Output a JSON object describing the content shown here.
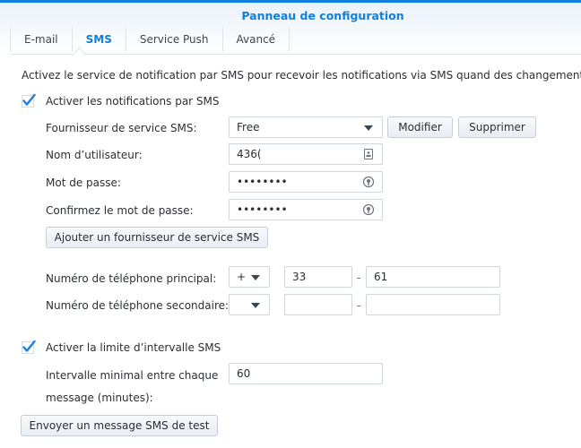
{
  "window": {
    "title": "Panneau de configuration",
    "accent": "#0f7fe0"
  },
  "tabs": [
    {
      "label": "E-mail",
      "active": false
    },
    {
      "label": "SMS",
      "active": true
    },
    {
      "label": "Service Push",
      "active": false
    },
    {
      "label": "Avancé",
      "active": false
    }
  ],
  "description": "Activez le service de notification par SMS pour recevoir les notifications via SMS quand des changements d'é",
  "enable_sms": {
    "label": "Activer les notifications par SMS",
    "checked": true
  },
  "provider": {
    "label": "Fournisseur de service SMS:",
    "value": "Free",
    "modify_label": "Modifier",
    "delete_label": "Supprimer"
  },
  "username": {
    "label": "Nom d’utilisateur:",
    "value": "436("
  },
  "password": {
    "label": "Mot de passe:",
    "value": "••••••••"
  },
  "confirm_password": {
    "label": "Confirmez le mot de passe:",
    "value": "••••••••"
  },
  "add_provider_label": "Ajouter un fournisseur de service SMS",
  "primary_phone": {
    "label": "Numéro de téléphone principal:",
    "prefix": "+",
    "country_code": "33",
    "separator": "-",
    "number": "61"
  },
  "secondary_phone": {
    "label": "Numéro de téléphone secondaire:",
    "prefix": "",
    "country_code": "",
    "separator": "-",
    "number": ""
  },
  "interval_limit": {
    "label": "Activer la limite d’intervalle SMS",
    "checked": true
  },
  "interval": {
    "label_line1": "Intervalle minimal entre chaque",
    "label_line2": "message (minutes):",
    "value": "60"
  },
  "send_test_label": "Envoyer un message SMS de test"
}
